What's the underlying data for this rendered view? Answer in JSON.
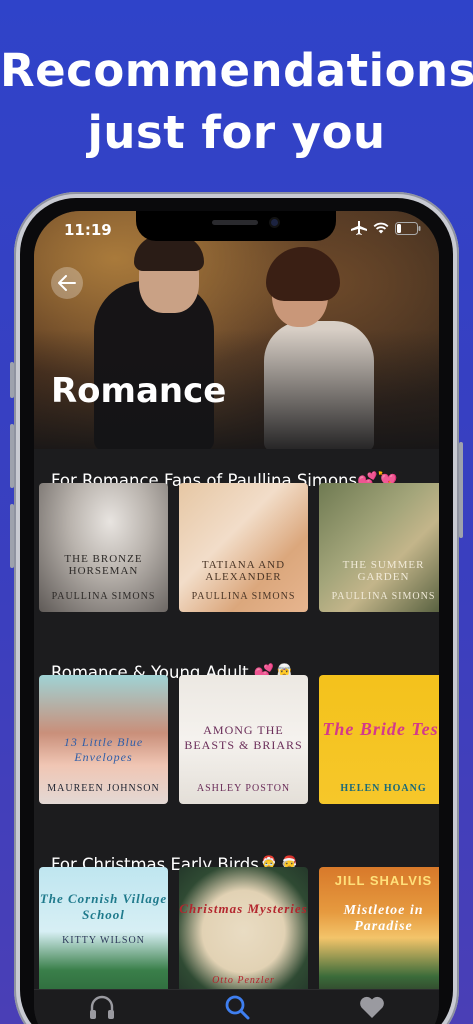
{
  "headline": {
    "line1": "Recommendations",
    "line2": "just for you"
  },
  "status_bar": {
    "time": "11:19"
  },
  "hero": {
    "title": "Romance"
  },
  "sections": [
    {
      "title": "For Romance Fans of Paullina Simons💕💘",
      "books": [
        {
          "title": "THE BRONZE HORSEMAN",
          "author": "PAULLINA SIMONS"
        },
        {
          "title": "TATIANA AND ALEXANDER",
          "author": "PAULLINA SIMONS"
        },
        {
          "title": "THE SUMMER GARDEN",
          "author": "PAULLINA SIMONS"
        }
      ]
    },
    {
      "title": "Romance & Young Adult 💕🧝‍♀️",
      "books": [
        {
          "title": "13 Little Blue Envelopes",
          "author": "MAUREEN JOHNSON"
        },
        {
          "title": "AMONG THE BEASTS & BRIARS",
          "author": "ASHLEY POSTON"
        },
        {
          "title": "The Bride Test",
          "author": "HELEN HOANG"
        }
      ]
    },
    {
      "title": "For Christmas Early Birds🤶🧑‍🎄",
      "books": [
        {
          "title": "The Cornish Village School",
          "author": "KITTY WILSON"
        },
        {
          "title": "Christmas Mysteries",
          "author": "Otto Penzler"
        },
        {
          "title": "Mistletoe in Paradise",
          "author": "JILL SHALVIS"
        }
      ]
    }
  ],
  "tabs": [
    {
      "icon": "headphones-icon"
    },
    {
      "icon": "search-icon"
    },
    {
      "icon": "heart-icon"
    }
  ]
}
